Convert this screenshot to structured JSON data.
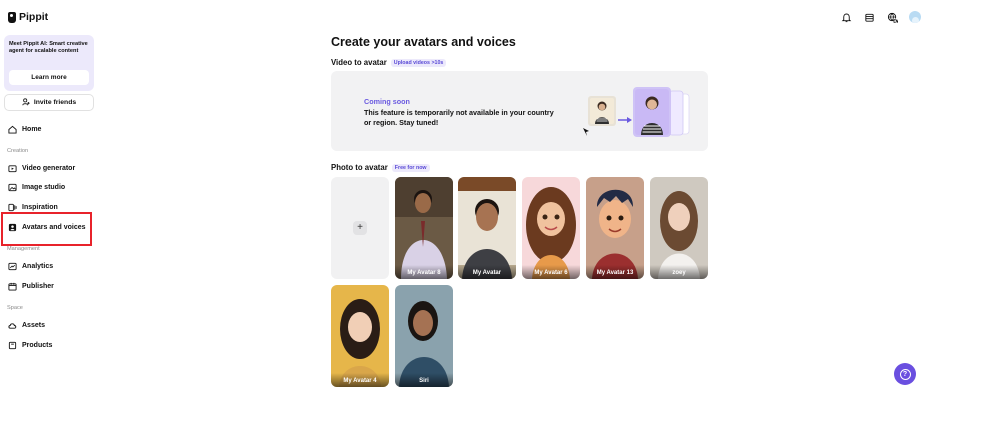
{
  "app": {
    "logo_text": "Pippit"
  },
  "sidebar": {
    "promo_text": "Meet Pippit AI: Smart creative agent for scalable content",
    "promo_button": "Learn more",
    "invite_button": "Invite friends",
    "home": "Home",
    "section_creation": "Creation",
    "video_generator": "Video generator",
    "image_studio": "Image studio",
    "inspiration": "Inspiration",
    "avatars_and_voices": "Avatars and voices",
    "section_management": "Management",
    "analytics": "Analytics",
    "publisher": "Publisher",
    "section_space": "Space",
    "assets": "Assets",
    "products": "Products"
  },
  "header": {
    "icons": [
      "bell-icon",
      "calendar-icon",
      "language-icon",
      "user-avatar"
    ]
  },
  "main": {
    "title": "Create your avatars and voices",
    "video_section": {
      "title": "Video to avatar",
      "badge": "Upload videos >10s",
      "coming_soon": "Coming soon",
      "notice": "This feature is temporarily not available in your country or region. Stay tuned!"
    },
    "photo_section": {
      "title": "Photo to avatar",
      "badge": "Free for now",
      "avatars": [
        {
          "name": "My Avatar 8"
        },
        {
          "name": "My Avatar"
        },
        {
          "name": "My Avatar 6"
        },
        {
          "name": "My Avatar 13"
        },
        {
          "name": "zoey"
        },
        {
          "name": "My Avatar 4"
        },
        {
          "name": "Siri"
        }
      ]
    }
  },
  "colors": {
    "accent": "#6a5ae0",
    "active_highlight": "#e8232b",
    "help_button": "#6a4fe0"
  }
}
